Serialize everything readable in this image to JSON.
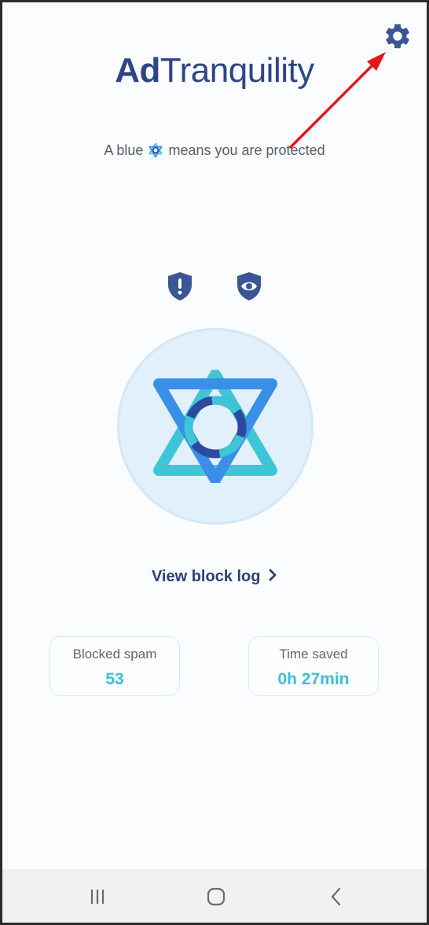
{
  "header": {
    "logo_bold": "Ad",
    "logo_regular": "Tranquility",
    "settings_icon": "gear-icon"
  },
  "tagline": {
    "before": "A blue",
    "after": "means you are protected"
  },
  "status_icons": [
    "shield-alert-icon",
    "eye-icon"
  ],
  "view_log": {
    "label": "View block log"
  },
  "stats": {
    "blocked_label": "Blocked spam",
    "blocked_value": "53",
    "time_label": "Time saved",
    "time_value": "0h 27min"
  },
  "colors": {
    "brand": "#2f4586",
    "accent": "#3cbfd6",
    "annotation_arrow": "#e8141c"
  },
  "navbar": {
    "icons": [
      "recent-apps-icon",
      "home-icon",
      "back-icon"
    ]
  }
}
